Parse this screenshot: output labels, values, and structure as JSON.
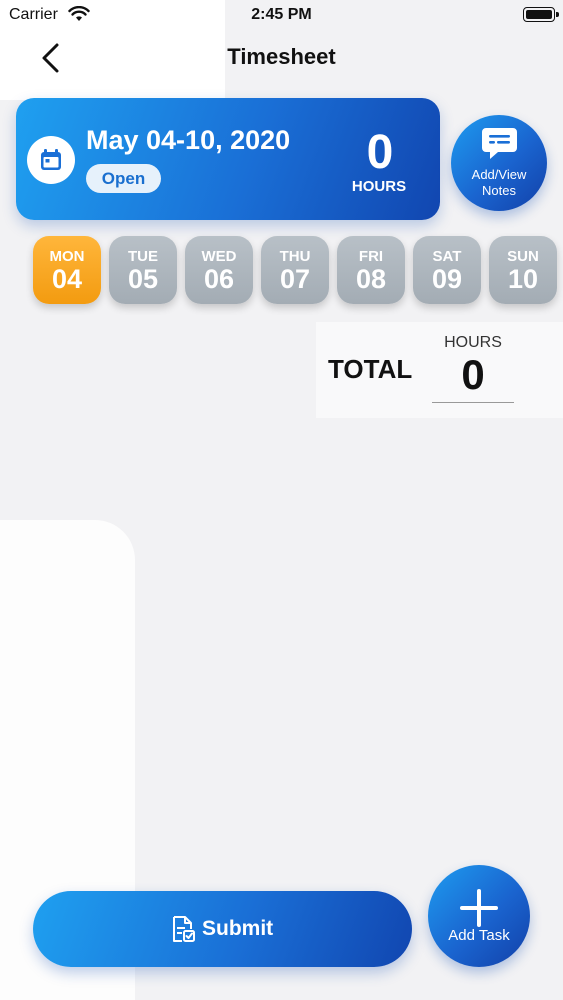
{
  "status_bar": {
    "carrier": "Carrier",
    "time": "2:45 PM"
  },
  "header": {
    "title": "Timesheet"
  },
  "week_card": {
    "date_range": "May 04-10, 2020",
    "status": "Open",
    "hours_value": "0",
    "hours_label": "HOURS"
  },
  "notes_button": {
    "label_line1": "Add/View",
    "label_line2": "Notes"
  },
  "days": [
    {
      "name": "MON",
      "num": "04",
      "selected": true
    },
    {
      "name": "TUE",
      "num": "05",
      "selected": false
    },
    {
      "name": "WED",
      "num": "06",
      "selected": false
    },
    {
      "name": "THU",
      "num": "07",
      "selected": false
    },
    {
      "name": "FRI",
      "num": "08",
      "selected": false
    },
    {
      "name": "SAT",
      "num": "09",
      "selected": false
    },
    {
      "name": "SUN",
      "num": "10",
      "selected": false
    }
  ],
  "total": {
    "label": "TOTAL",
    "hours_label": "HOURS",
    "hours_value": "0"
  },
  "submit_button": {
    "label": "Submit"
  },
  "add_task_button": {
    "label": "Add Task"
  },
  "colors": {
    "primary_blue": "#1a6fd6",
    "selected_day": "#f39b10",
    "inactive_day": "#a3acb4"
  }
}
